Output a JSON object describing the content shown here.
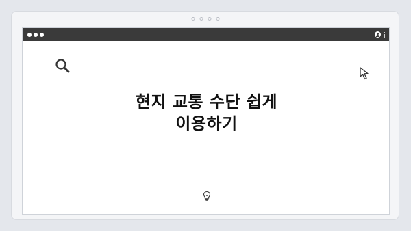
{
  "headline": {
    "line1": "현지 교통 수단 쉽게",
    "line2": "이용하기"
  },
  "icons": {
    "search": "search-icon",
    "cursor": "cursor-icon",
    "bulb": "lightbulb-icon",
    "user": "user-icon",
    "menu": "kebab-menu-icon"
  },
  "colors": {
    "titlebar": "#3a3a3a",
    "page_background": "#ffffff",
    "outer_frame": "#f4f5f7",
    "text": "#111111"
  }
}
